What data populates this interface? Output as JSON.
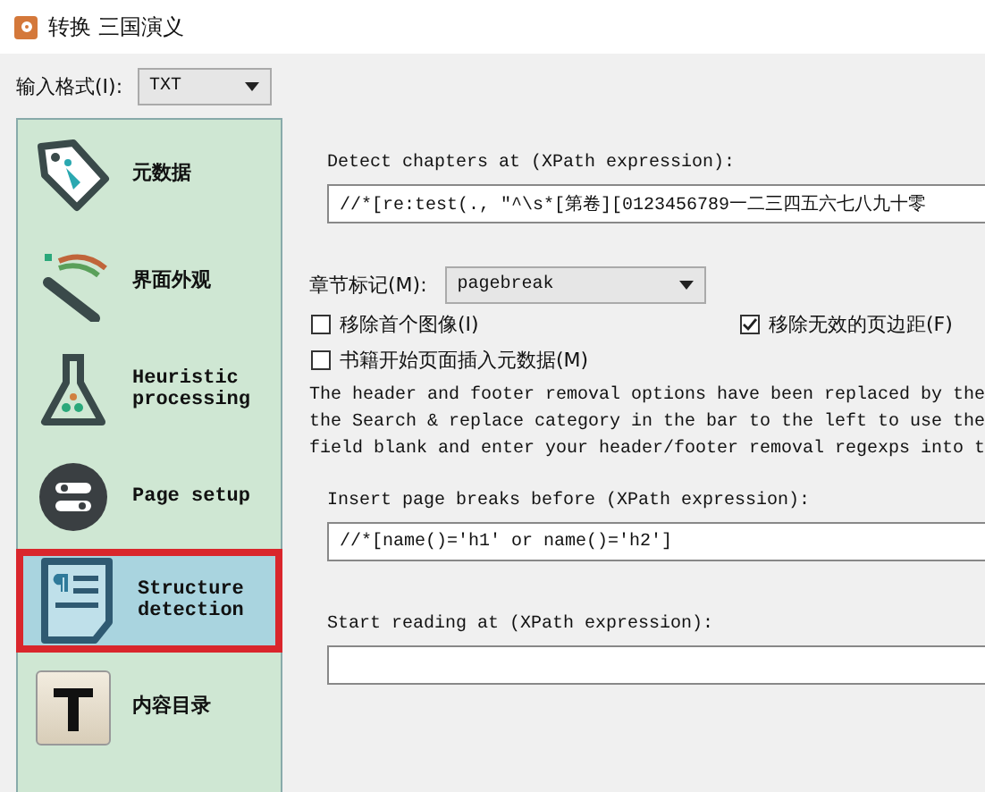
{
  "window": {
    "title": "转换 三国演义"
  },
  "input_format": {
    "label": "输入格式(I):",
    "value": "TXT"
  },
  "sidebar": {
    "items": [
      {
        "label": "元数据",
        "selected": false
      },
      {
        "label": "界面外观",
        "selected": false
      },
      {
        "label": "Heuristic processing",
        "selected": false
      },
      {
        "label": "Page setup",
        "selected": false
      },
      {
        "label": "Structure detection",
        "selected": true
      },
      {
        "label": "内容目录",
        "selected": false
      }
    ]
  },
  "detect_chapters": {
    "label": "Detect chapters at (XPath expression):",
    "value": "//*[re:test(., \"^\\s*[第卷][0123456789一二三四五六七八九十零"
  },
  "chapter_mark": {
    "label": "章节标记(M):",
    "value": "pagebreak"
  },
  "checkboxes": [
    {
      "label": "移除首个图像(I)",
      "checked": false
    },
    {
      "label": "移除无效的页边距(F)",
      "checked": true
    },
    {
      "label": "书籍开始页面插入元数据(M)",
      "checked": false
    }
  ],
  "note": {
    "lines": [
      "The header and footer removal options have been replaced by the",
      "the Search & replace category in the bar to the left to use the",
      "field blank and enter your header/footer removal regexps into t"
    ]
  },
  "page_breaks": {
    "label": "Insert page breaks before (XPath expression):",
    "value": "//*[name()='h1' or name()='h2']"
  },
  "start_reading": {
    "label": "Start reading at (XPath expression):"
  }
}
